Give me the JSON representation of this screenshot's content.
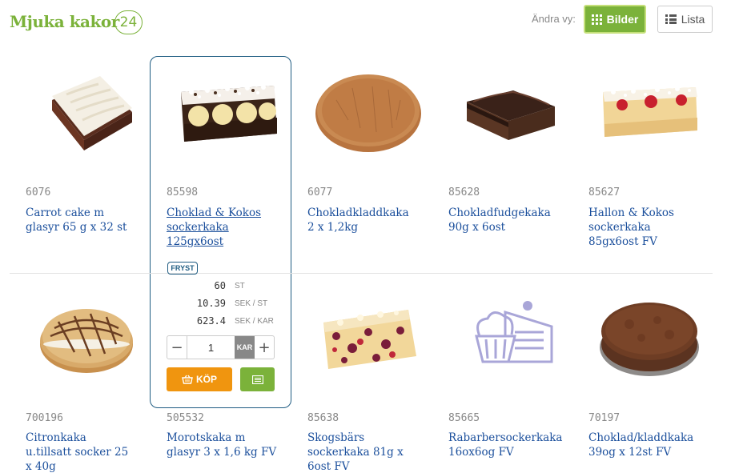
{
  "header": {
    "title": "Mjuka kakor",
    "count": "24",
    "view_label": "Ändra vy:",
    "view_bilder": "Bilder",
    "view_lista": "Lista"
  },
  "products": [
    {
      "sku": "6076",
      "name_lines": [
        "Carrot cake m",
        "glasyr 65 g x 32 st"
      ]
    },
    {
      "sku": "85598",
      "name_lines": [
        "Choklad & Kokos",
        "sockerkaka",
        "125gx6ost"
      ]
    },
    {
      "sku": "6077",
      "name_lines": [
        "Chokladkladdkaka",
        "2 x 1,2kg"
      ]
    },
    {
      "sku": "85628",
      "name_lines": [
        "Chokladfudgekaka",
        "90g x 6ost"
      ]
    },
    {
      "sku": "85627",
      "name_lines": [
        "Hallon & Kokos",
        "sockerkaka",
        "85gx6ost FV"
      ]
    },
    {
      "sku": "700196",
      "name_lines": [
        "Citronkaka",
        "u.tillsatt socker 25",
        "x 40g"
      ]
    },
    {
      "sku": "505532",
      "name_lines": [
        "Morotskaka m",
        "glasyr 3 x 1,6 kg FV"
      ]
    },
    {
      "sku": "85638",
      "name_lines": [
        "Skogsbärs",
        "sockerkaka 81g x",
        "6ost FV"
      ]
    },
    {
      "sku": "85665",
      "name_lines": [
        "Rabarbersockerkaka",
        "16ox6og FV"
      ]
    },
    {
      "sku": "70197",
      "name_lines": [
        "Choklad/kladdkaka",
        "39og x 12st FV"
      ]
    }
  ],
  "selected": {
    "badge": "FRYST",
    "pack_qty": "60",
    "pack_unit": "ST",
    "price_each": "10.39",
    "price_each_unit": "SEK / ST",
    "price_box": "623.4",
    "price_box_unit": "SEK / KAR",
    "quantity": "1",
    "quantity_unit": "KAR",
    "buy_label": "KÖP"
  }
}
